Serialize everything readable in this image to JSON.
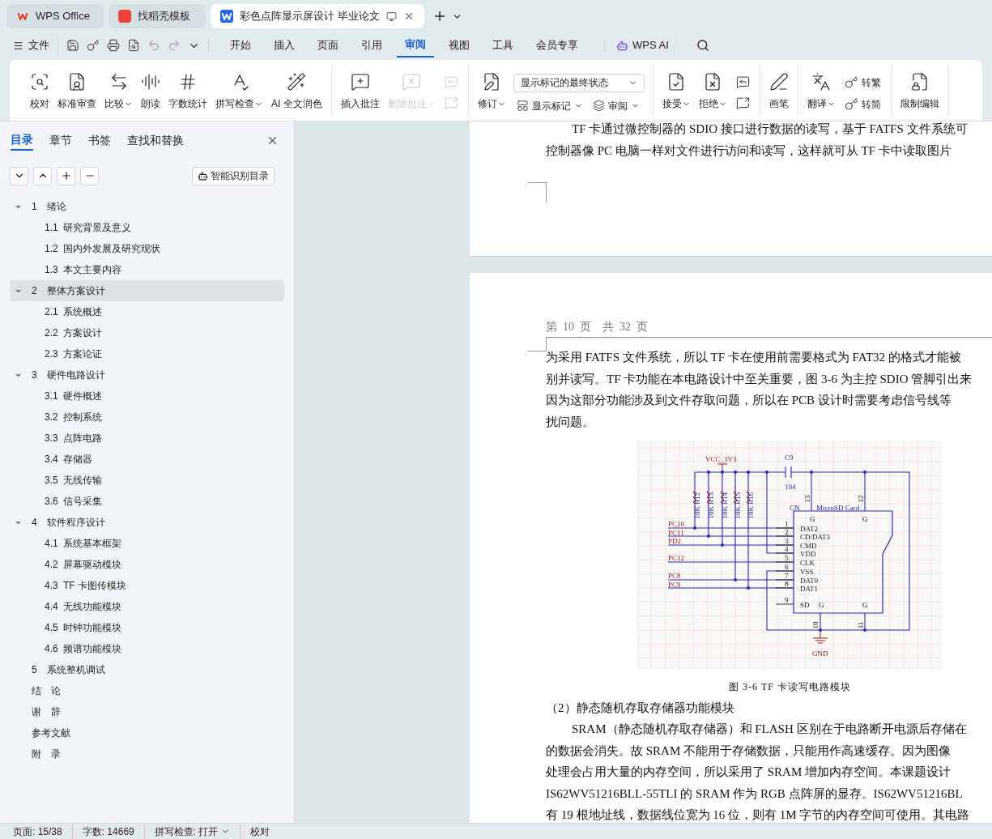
{
  "title_tabs": [
    {
      "label": "WPS Office",
      "selected": false,
      "kind": "home"
    },
    {
      "label": "找稻壳模板",
      "selected": false,
      "kind": "template"
    },
    {
      "label": "彩色点阵显示屏设计 毕业论文",
      "selected": true,
      "kind": "document"
    }
  ],
  "menu": {
    "file": "文件",
    "tabs": [
      {
        "label": "开始",
        "selected": false
      },
      {
        "label": "插入",
        "selected": false
      },
      {
        "label": "页面",
        "selected": false
      },
      {
        "label": "引用",
        "selected": false
      },
      {
        "label": "审阅",
        "selected": true
      },
      {
        "label": "视图",
        "selected": false
      },
      {
        "label": "工具",
        "selected": false
      },
      {
        "label": "会员专享",
        "selected": false
      }
    ],
    "ai": "WPS AI"
  },
  "ribbon": [
    {
      "buttons": [
        {
          "kind": "large",
          "label": "校对",
          "dropdown": false,
          "disabled": false
        },
        {
          "kind": "large",
          "label": "标准审查",
          "dropdown": false,
          "disabled": false
        },
        {
          "kind": "large",
          "label": "比较",
          "dropdown": true,
          "disabled": false
        },
        {
          "kind": "large",
          "label": "朗读",
          "dropdown": false,
          "disabled": false
        },
        {
          "kind": "large",
          "label": "字数统计",
          "dropdown": false,
          "disabled": false
        },
        {
          "kind": "large",
          "label": "拼写检查",
          "dropdown": true,
          "disabled": false
        },
        {
          "kind": "large",
          "label": "AI 全文润色",
          "dropdown": false,
          "disabled": false
        }
      ]
    },
    {
      "buttons": [
        {
          "kind": "large",
          "label": "插入批注",
          "dropdown": false,
          "disabled": false
        },
        {
          "kind": "large",
          "label": "删除批注",
          "dropdown": true,
          "disabled": true
        },
        {
          "kind": "icon",
          "disabled": true
        },
        {
          "kind": "icon",
          "disabled": true
        }
      ]
    },
    {
      "buttons": [
        {
          "kind": "large",
          "label": "修订",
          "dropdown": true,
          "disabled": false
        },
        {
          "kind": "select",
          "label": "显示标记的最终状态",
          "dropdown": true,
          "disabled": false
        },
        {
          "kind": "small",
          "label": "显示标记",
          "dropdown": true,
          "disabled": false
        },
        {
          "kind": "small",
          "label": "审阅",
          "dropdown": true,
          "disabled": false
        }
      ]
    },
    {
      "buttons": [
        {
          "kind": "large",
          "label": "接受",
          "dropdown": true,
          "disabled": false
        },
        {
          "kind": "large",
          "label": "拒绝",
          "dropdown": true,
          "disabled": false
        },
        {
          "kind": "icon",
          "disabled": false
        },
        {
          "kind": "icon",
          "disabled": false
        }
      ]
    },
    {
      "buttons": [
        {
          "kind": "large",
          "label": "画笔",
          "dropdown": false,
          "disabled": false
        }
      ]
    },
    {
      "buttons": [
        {
          "kind": "large",
          "label": "翻译",
          "dropdown": true,
          "disabled": false
        },
        {
          "kind": "small",
          "label": "转繁",
          "dropdown": false,
          "disabled": false
        },
        {
          "kind": "small",
          "label": "转简",
          "dropdown": false,
          "disabled": false
        }
      ]
    },
    {
      "buttons": [
        {
          "kind": "large",
          "label": "限制编辑",
          "dropdown": false,
          "disabled": false
        }
      ]
    }
  ],
  "nav_panel": {
    "tabs": [
      {
        "label": "目录",
        "selected": true
      },
      {
        "label": "章节",
        "selected": false
      },
      {
        "label": "书签",
        "selected": false
      },
      {
        "label": "查找和替换",
        "selected": false
      }
    ],
    "smart_button": "智能识别目录",
    "toc": [
      {
        "number": "1",
        "title": "绪论",
        "selected": false,
        "expanded": true,
        "children": [
          {
            "number": "1.1",
            "title": "研究背景及意义"
          },
          {
            "number": "1.2",
            "title": "国内外发展及研究现状"
          },
          {
            "number": "1.3",
            "title": "本文主要内容"
          }
        ]
      },
      {
        "number": "2",
        "title": "整体方案设计",
        "selected": true,
        "expanded": true,
        "children": [
          {
            "number": "2.1",
            "title": "系统概述"
          },
          {
            "number": "2.2",
            "title": "方案设计"
          },
          {
            "number": "2.3",
            "title": "方案论证"
          }
        ]
      },
      {
        "number": "3",
        "title": "硬件电路设计",
        "selected": false,
        "expanded": true,
        "children": [
          {
            "number": "3.1",
            "title": "硬件概述"
          },
          {
            "number": "3.2",
            "title": "控制系统"
          },
          {
            "number": "3.3",
            "title": "点阵电路"
          },
          {
            "number": "3.4",
            "title": "存储器"
          },
          {
            "number": "3.5",
            "title": "无线传输"
          },
          {
            "number": "3.6",
            "title": "信号采集"
          }
        ]
      },
      {
        "number": "4",
        "title": "软件程序设计",
        "selected": false,
        "expanded": true,
        "children": [
          {
            "number": "4.1",
            "title": "系统基本框架"
          },
          {
            "number": "4.2",
            "title": "屏幕驱动模块"
          },
          {
            "number": "4.3",
            "title": "TF 卡图传模块"
          },
          {
            "number": "4.4",
            "title": "无线功能模块"
          },
          {
            "number": "4.5",
            "title": "时钟功能模块"
          },
          {
            "number": "4.6",
            "title": "频谱功能模块"
          }
        ]
      },
      {
        "number": "5",
        "title": "系统整机调试",
        "selected": false
      },
      {
        "title": "结　论",
        "selected": false
      },
      {
        "title": "谢　辞",
        "selected": false
      },
      {
        "title": "参考文献",
        "selected": false
      },
      {
        "title": "附　录",
        "selected": false
      }
    ]
  },
  "document": {
    "page_1": {
      "paragraphs": [
        {
          "indent": true,
          "lines": [
            "TF 卡通过微控制器的 SDIO 接口进行数据的读写，基于 FATFS 文件系统可",
            "控制器像 PC 电脑一样对文件进行访问和读写，这样就可从 TF 卡中读取图片"
          ]
        }
      ]
    },
    "page_2": {
      "header": "第  10  页    共  32  页",
      "paragraphs_before": [
        {
          "indent": false,
          "lines": [
            "为采用 FATFS 文件系统，所以 TF 卡在使用前需要格式为 FAT32 的格式才能被",
            "别并读写。TF 卡功能在本电路设计中至关重要，图 3-6 为主控 SDIO 管脚引出来",
            "因为这部分功能涉及到文件存取问题，所以在 PCB 设计时需要考虑信号线等",
            "扰问题。"
          ]
        }
      ],
      "figure": {
        "labels": [
          "VCC_3V3",
          "C9",
          "104",
          "10K R12",
          "10K R13",
          "10K R14",
          "10K R15",
          "10K R16",
          "13",
          "12",
          "CN",
          "MicroSD Card",
          "PC10",
          "PC11",
          "PD2",
          "PC12",
          "PC8",
          "PC9",
          "1",
          "2",
          "3",
          "4",
          "5",
          "6",
          "7",
          "8",
          "9",
          "DAT2",
          "CD/DAT3",
          "CMD",
          "VDD",
          "CLK",
          "VSS",
          "DAT0",
          "DAT1",
          "SD",
          "G",
          "G",
          "G",
          "G",
          "10",
          "11",
          "GND"
        ],
        "caption": "图 3-6 TF 卡读写电路模块"
      },
      "heading": "（2）静态随机存取存储器功能模块",
      "paragraphs_after": [
        {
          "indent": true,
          "lines": [
            "SRAM（静态随机存取存储器）和 FLASH 区别在于电路断开电源后存储在",
            "的数据会消失。故 SRAM 不能用于存储数据，只能用作高速缓存。因为图像",
            "处理会占用大量的内存空间，所以采用了 SRAM 增加内存空间。本课题设计",
            "IS62WV51216BLL-55TLI 的 SRAM 作为 RGB 点阵屏的显存。IS62WV51216BL",
            "有 19 根地址线，数据线位宽为 16 位，则有 1M 字节的内存空间可使用。其电路"
          ]
        }
      ]
    }
  },
  "status_bar": {
    "page": "页面: 15/38",
    "words": "字数: 14669",
    "spell": "拼写检查: 打开",
    "proof": "校对"
  }
}
